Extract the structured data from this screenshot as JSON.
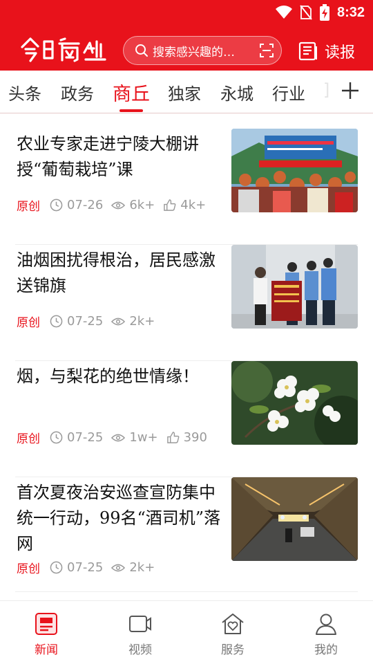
{
  "status_bar": {
    "time": "8:32"
  },
  "app": {
    "logo_text": "今日商丘",
    "search_placeholder": "搜索感兴趣的…",
    "dubao_label": "读报"
  },
  "tabs": [
    {
      "label": "头条",
      "active": false
    },
    {
      "label": "政务",
      "active": false
    },
    {
      "label": "商丘",
      "active": true
    },
    {
      "label": "独家",
      "active": false
    },
    {
      "label": "永城",
      "active": false
    },
    {
      "label": "行业",
      "active": false
    },
    {
      "label": "]",
      "active": false
    }
  ],
  "articles": [
    {
      "title": "农业专家走进宁陵大棚讲授“葡萄栽培”课",
      "tag": "原创",
      "date": "07-26",
      "views": "6k+",
      "likes": "4k+"
    },
    {
      "title": "油烟困扰得根治，居民感激送锦旗",
      "tag": "原创",
      "date": "07-25",
      "views": "2k+",
      "likes": ""
    },
    {
      "title": "烟，与梨花的绝世情缘！",
      "tag": "原创",
      "date": "07-25",
      "views": "1w+",
      "likes": "390"
    },
    {
      "title": "首次夏夜治安巡查宣防集中统一行动，99名“酒司机”落网",
      "tag": "原创",
      "date": "07-25",
      "views": "2k+",
      "likes": ""
    }
  ],
  "bottom_nav": [
    {
      "label": "新闻",
      "icon": "news-icon",
      "active": true
    },
    {
      "label": "视频",
      "icon": "video-icon",
      "active": false
    },
    {
      "label": "服务",
      "icon": "service-icon",
      "active": false
    },
    {
      "label": "我的",
      "icon": "profile-icon",
      "active": false
    }
  ],
  "colors": {
    "brand": "#e8121b",
    "muted": "#9a9a9a"
  }
}
